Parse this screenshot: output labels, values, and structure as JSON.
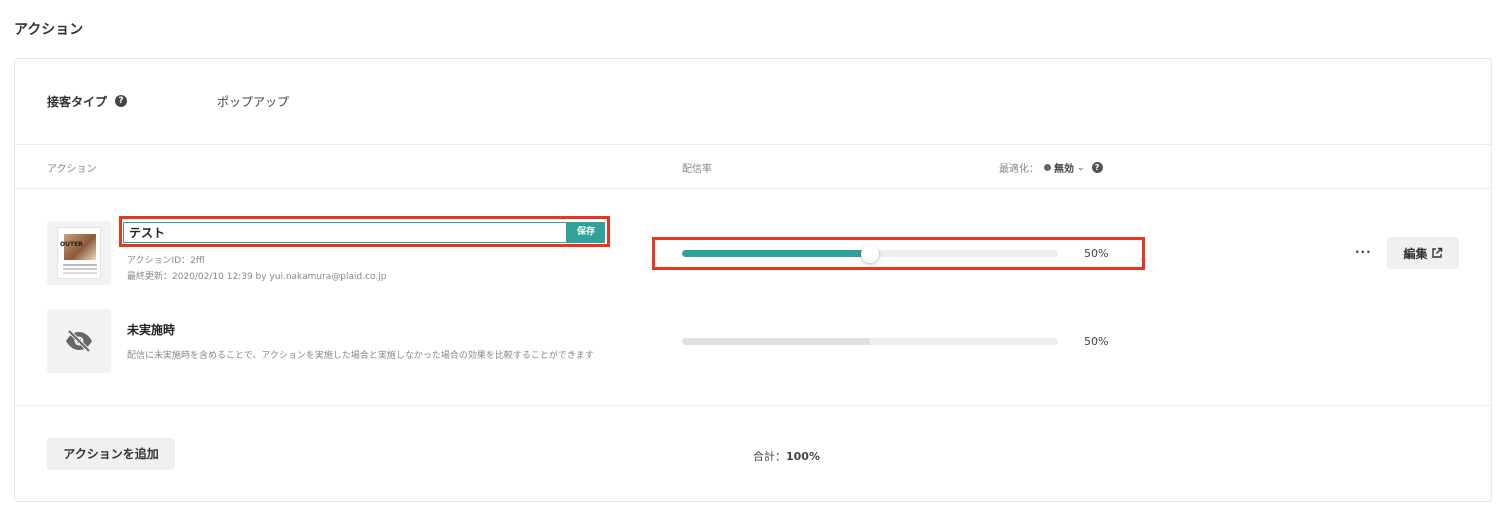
{
  "page": {
    "title": "アクション"
  },
  "customer_type": {
    "label": "接客タイプ",
    "value": "ポップアップ"
  },
  "table_header": {
    "action": "アクション",
    "rate": "配信率",
    "optimize_label": "最適化：",
    "optimize_value": "無効"
  },
  "actions": [
    {
      "thumbnail_text": "OUTER",
      "name": "テスト",
      "save_label": "保存",
      "action_id": "アクションID：2ffl",
      "updated": "最終更新：2020/02/10 12:39 by yui.nakamura@plaid.co.jp",
      "rate": 50,
      "rate_label": "50%",
      "more_label": "···",
      "edit_label": "編集"
    },
    {
      "title": "未実施時",
      "description": "配信に未実施時を含めることで、アクションを実施した場合と実施しなかった場合の効果を比較することができます",
      "rate": 50,
      "rate_label": "50%"
    }
  ],
  "footer": {
    "add_label": "アクションを追加",
    "total_label": "合計：",
    "total_value": "100%"
  },
  "colors": {
    "accent": "#2fa39a",
    "highlight": "#e8361c"
  }
}
